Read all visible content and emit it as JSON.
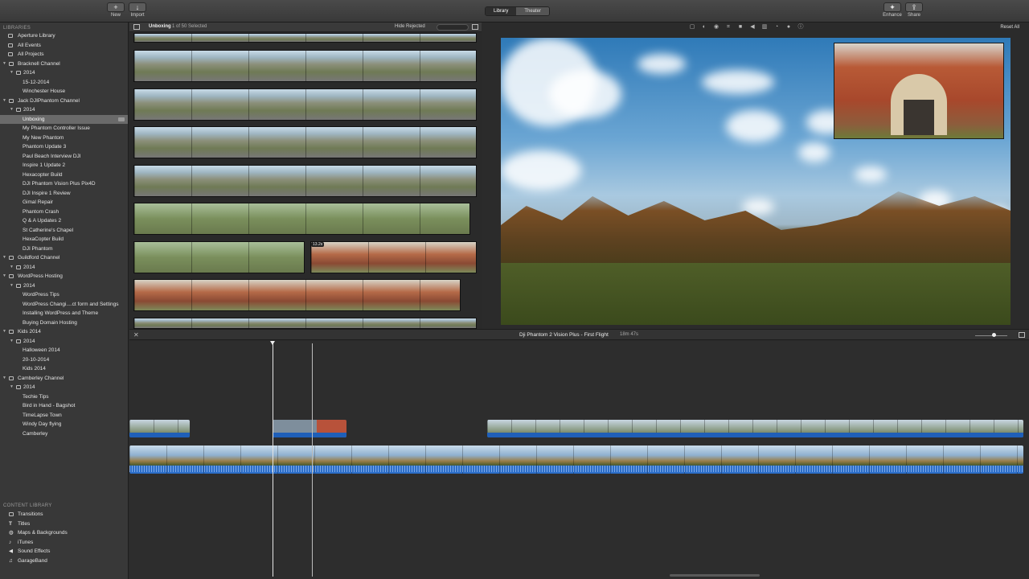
{
  "toolbar": {
    "new_label": "New",
    "import_label": "Import",
    "library_tab": "Library",
    "theater_tab": "Theater",
    "enhance_label": "Enhance",
    "share_label": "Share"
  },
  "sidebar": {
    "libraries_header": "LIBRARIES",
    "items": [
      {
        "label": "Aperture Library"
      },
      {
        "label": "All Events"
      },
      {
        "label": "All Projects"
      },
      {
        "label": "Bracknell Channel"
      },
      {
        "label": "2014"
      },
      {
        "label": "15-12-2014"
      },
      {
        "label": "Winchester House"
      },
      {
        "label": "Jack DJIPhantom Channel"
      },
      {
        "label": "2014"
      },
      {
        "label": "Unboxing"
      },
      {
        "label": "My Phantom Controller Issue"
      },
      {
        "label": "My New Phantom"
      },
      {
        "label": "Phantom Update 3"
      },
      {
        "label": "Paul Beach Interview DJI"
      },
      {
        "label": "Inspire 1 Update 2"
      },
      {
        "label": "Hexacopter Build"
      },
      {
        "label": "DJI Phantom Vision Plus Pix4D"
      },
      {
        "label": "DJI Inspire 1 Review"
      },
      {
        "label": "Gimal Repair"
      },
      {
        "label": "Phantom Crash"
      },
      {
        "label": "Q & A Updates 2"
      },
      {
        "label": "St Catherine's Chapel"
      },
      {
        "label": "HexaCopter Build"
      },
      {
        "label": "DJI Phantom"
      },
      {
        "label": "Guildford Channel"
      },
      {
        "label": "2014"
      },
      {
        "label": "WordPress Hosting"
      },
      {
        "label": "2014"
      },
      {
        "label": "WordPress Tips"
      },
      {
        "label": "WordPress Changi....ct form and Settings"
      },
      {
        "label": "Installing WordPress and Theme"
      },
      {
        "label": "Buying Domain Hosting"
      },
      {
        "label": "Kids 2014"
      },
      {
        "label": "2014"
      },
      {
        "label": "Halloween 2014"
      },
      {
        "label": "20-10-2014"
      },
      {
        "label": "Kids 2014"
      },
      {
        "label": "Camberley Channel"
      },
      {
        "label": "2014"
      },
      {
        "label": "Techie Tips"
      },
      {
        "label": "Bird in Hand - Bagshot"
      },
      {
        "label": "TimeLapse Town"
      },
      {
        "label": "Windy Day flying"
      },
      {
        "label": "Camberley"
      }
    ]
  },
  "content_library": {
    "header": "CONTENT LIBRARY",
    "items": [
      {
        "label": "Transitions"
      },
      {
        "label": "Titles"
      },
      {
        "label": "Maps & Backgrounds"
      },
      {
        "label": "iTunes"
      },
      {
        "label": "Sound Effects"
      },
      {
        "label": "GarageBand"
      }
    ]
  },
  "browser": {
    "event_title": "Unboxing",
    "selection_status": "1 of 50 Selected",
    "filter_label": "Hide Rejected",
    "clip_badge": "13.2s"
  },
  "viewer": {
    "reset_label": "Reset All"
  },
  "timeline": {
    "project_title": "Dji Phantom 2 Vision Plus - First Flight",
    "duration": "18m 47s"
  },
  "colors": {
    "accent_audio": "#1f5fb8",
    "toolbar_bg": "#404040",
    "sidebar_bg": "#383838"
  }
}
